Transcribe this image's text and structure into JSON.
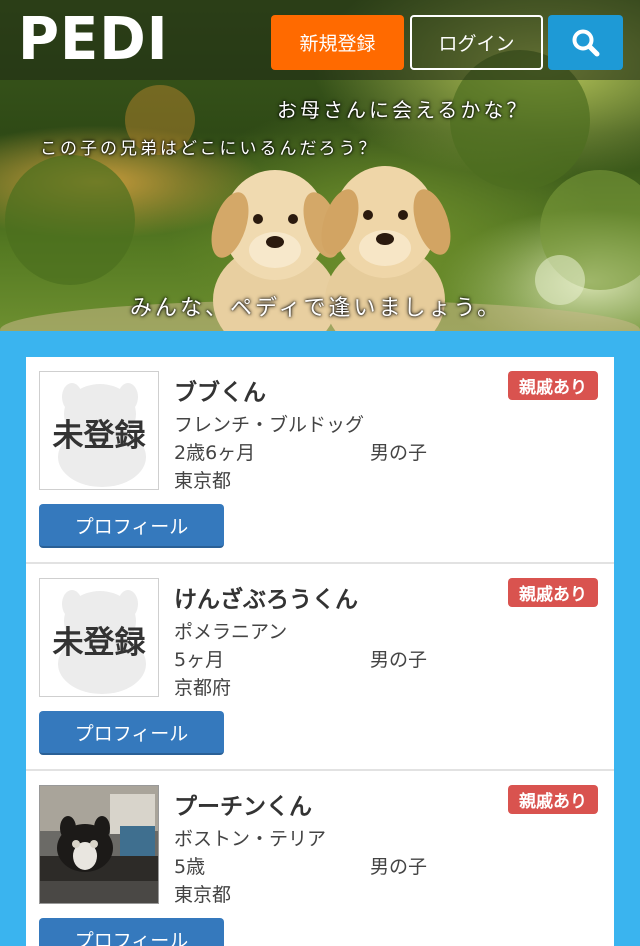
{
  "header": {
    "logo": "PEDI",
    "register_label": "新規登録",
    "login_label": "ログイン",
    "search_icon": "search-icon"
  },
  "hero": {
    "line1": "お母さんに会えるかな？",
    "line2": "この子の兄弟はどこにいるんだろう？",
    "line3": "みんな、ペディで逢いましょう。"
  },
  "colors": {
    "register": "#ff6a00",
    "search": "#1e9ad6",
    "background": "#3ab4ef",
    "badge": "#d9534f",
    "profile_button": "#3579bd"
  },
  "pets": [
    {
      "name": "ブブくん",
      "badge": "親戚あり",
      "breed": "フレンチ・ブルドッグ",
      "age": "2歳6ヶ月",
      "sex": "男の子",
      "area": "東京都",
      "photo_label": "未登録",
      "profile_label": "プロフィール"
    },
    {
      "name": "けんざぶろうくん",
      "badge": "親戚あり",
      "breed": "ポメラニアン",
      "age": "5ヶ月",
      "sex": "男の子",
      "area": "京都府",
      "photo_label": "未登録",
      "profile_label": "プロフィール"
    },
    {
      "name": "プーチンくん",
      "badge": "親戚あり",
      "breed": "ボストン・テリア",
      "age": "5歳",
      "sex": "男の子",
      "area": "東京都",
      "photo_label": "",
      "profile_label": "プロフィール"
    }
  ]
}
